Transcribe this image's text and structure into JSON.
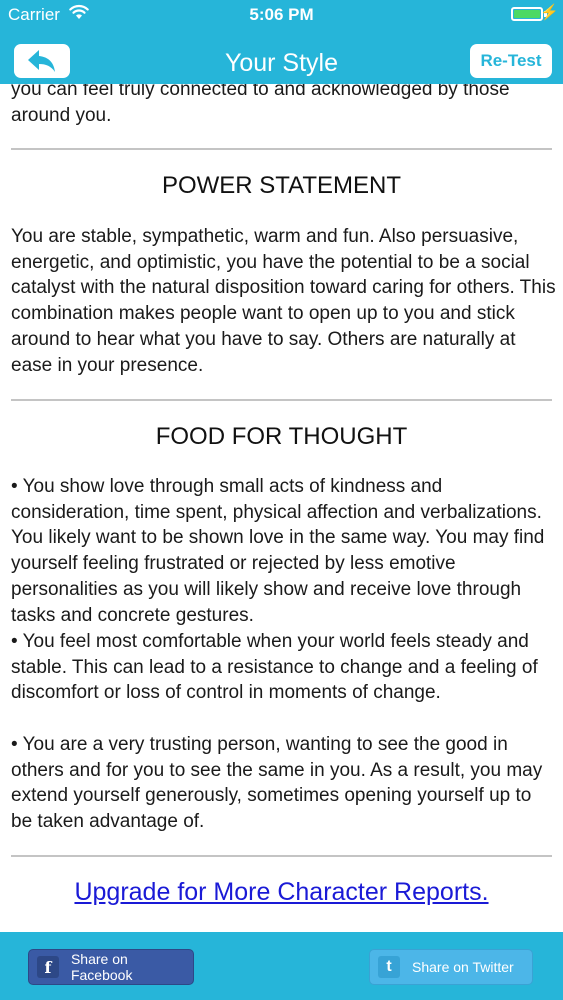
{
  "status_bar": {
    "carrier": "Carrier",
    "time": "5:06 PM",
    "battery_color": "#4cd964"
  },
  "nav": {
    "title": "Your Style",
    "back_icon": "back-arrow-icon",
    "retest_label": "Re-Test",
    "bar_color": "#26b5d9"
  },
  "content": {
    "intro_tail": "you can feel truly connected to and acknowledged by those around you.",
    "power_statement": {
      "heading": "POWER STATEMENT",
      "text": "You are stable, sympathetic, warm and fun. Also persuasive, energetic, and optimistic, you have the potential to be a social catalyst with the natural disposition toward caring for others. This combination makes people want to open up to you and stick around to hear what you have to say. Others are naturally at ease in your presence."
    },
    "food_for_thought": {
      "heading": "FOOD FOR THOUGHT",
      "bullets": [
        "• You show love through small acts of kindness and consideration, time spent, physical affection and verbalizations. You likely want to be shown love in the same way. You may find yourself feeling frustrated or rejected by less emotive personalities as you will likely show and receive love through tasks and concrete gestures.",
        "• You feel most comfortable when your world feels steady and stable. This can lead to a resistance to change and a feeling of discomfort or loss of control in moments of change.",
        "• You are a very trusting person, wanting to see the good in others and for you to see the same in you. As a result, you may extend yourself generously, sometimes opening yourself up to be taken advantage of."
      ]
    },
    "upgrade_link": "Upgrade for More Character Reports."
  },
  "share": {
    "facebook_label": "Share on Facebook",
    "facebook_icon": "f",
    "twitter_label": "Share on Twitter",
    "twitter_icon": "t",
    "facebook_color": "#3a5aa5",
    "twitter_color": "#4cb6e8"
  }
}
